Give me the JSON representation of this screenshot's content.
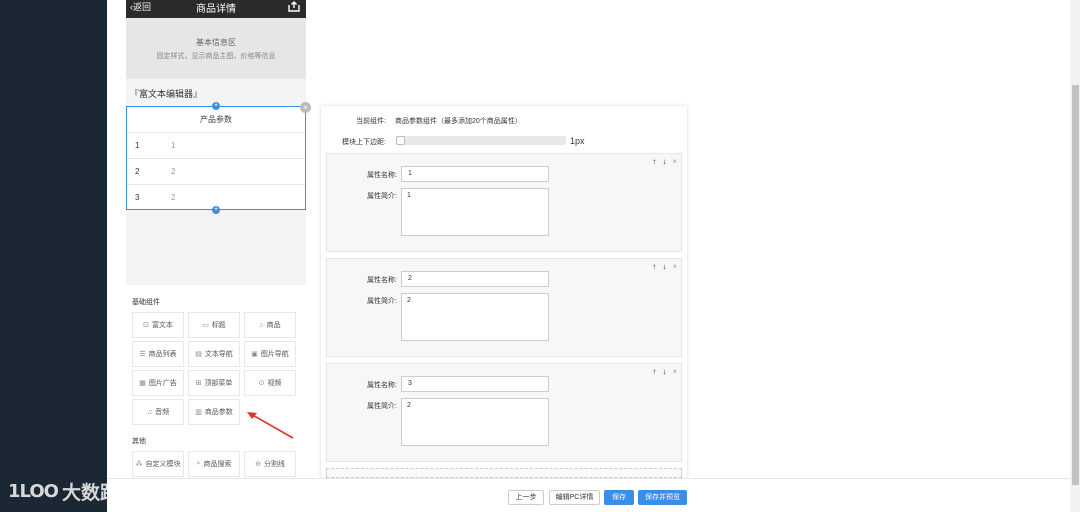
{
  "phone": {
    "back_label": "返回",
    "title": "商品详情",
    "basic_info_title": "基本信息区",
    "basic_info_desc": "固定样式，显示商品主图、价格等信息",
    "rich_editor_label": "『富文本编辑器』",
    "param_header": "产品参数",
    "param_rows": [
      {
        "name": "1",
        "value": "1"
      },
      {
        "name": "2",
        "value": "2"
      },
      {
        "name": "3",
        "value": "2"
      }
    ]
  },
  "palette": {
    "basic_title": "基础组件",
    "other_title": "其他",
    "basic_items": [
      {
        "label": "富文本",
        "icon": "rich-text-icon"
      },
      {
        "label": "标题",
        "icon": "title-icon"
      },
      {
        "label": "商品",
        "icon": "product-icon"
      },
      {
        "label": "商品列表",
        "icon": "list-icon"
      },
      {
        "label": "文本导航",
        "icon": "text-nav-icon"
      },
      {
        "label": "图片导航",
        "icon": "image-nav-icon"
      },
      {
        "label": "图片广告",
        "icon": "image-ad-icon"
      },
      {
        "label": "顶部菜单",
        "icon": "top-menu-icon"
      },
      {
        "label": "视频",
        "icon": "video-icon"
      },
      {
        "label": "音频",
        "icon": "audio-icon"
      },
      {
        "label": "商品参数",
        "icon": "params-icon"
      }
    ],
    "other_items": [
      {
        "label": "自定义模块",
        "icon": "custom-module-icon"
      },
      {
        "label": "商品搜索",
        "icon": "search-icon"
      },
      {
        "label": "分割线",
        "icon": "divider-icon"
      }
    ]
  },
  "editor": {
    "current_label": "当前组件:",
    "current_value": "商品参数组件（最多添加20个商品属性）",
    "margin_label": "模块上下边距:",
    "margin_value": "1px",
    "margin_level": 0,
    "name_label": "属性名称:",
    "desc_label": "属性简介:",
    "attributes": [
      {
        "name": "1",
        "desc": "1"
      },
      {
        "name": "2",
        "desc": "2"
      },
      {
        "name": "3",
        "desc": "2"
      }
    ]
  },
  "bottom_bar": {
    "prev": "上一步",
    "edit_pc": "编辑PC详情",
    "save": "保存",
    "save_preview": "保存并预览"
  },
  "watermark": {
    "logo": "1LOO",
    "text": "大数跨境"
  },
  "colors": {
    "accent": "#3a8ee6",
    "sidebar": "#1b2733",
    "phone_header": "#2b2b2b"
  }
}
